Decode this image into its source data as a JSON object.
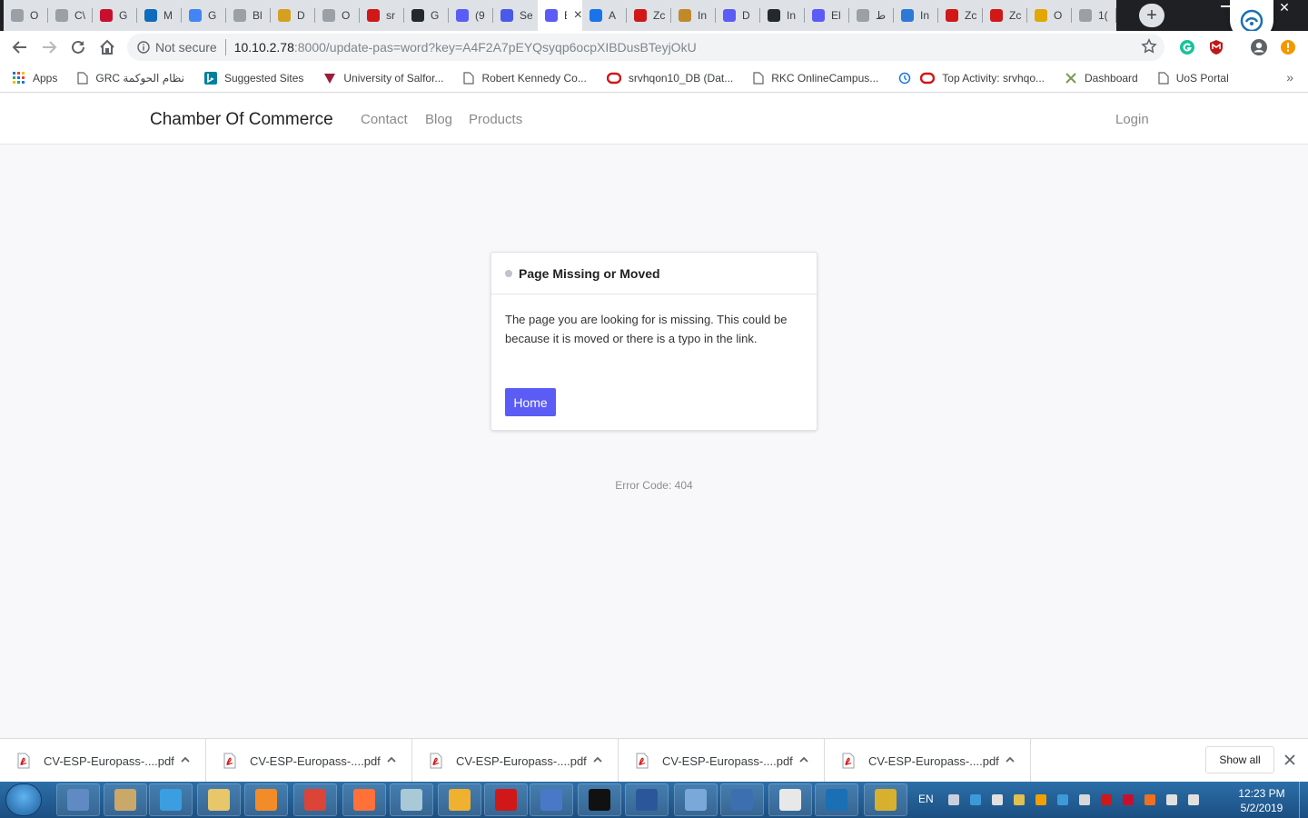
{
  "browser": {
    "tabs": [
      {
        "title": "O"
      },
      {
        "title": "C\\"
      },
      {
        "title": "G"
      },
      {
        "title": "M"
      },
      {
        "title": "G"
      },
      {
        "title": "Bl"
      },
      {
        "title": "D"
      },
      {
        "title": "O"
      },
      {
        "title": "sr"
      },
      {
        "title": "G"
      },
      {
        "title": "(9"
      },
      {
        "title": "Se"
      },
      {
        "title": "E"
      },
      {
        "title": "A"
      },
      {
        "title": "Zc"
      },
      {
        "title": "In"
      },
      {
        "title": "D"
      },
      {
        "title": "In"
      },
      {
        "title": "El"
      },
      {
        "title": "ط"
      },
      {
        "title": "In"
      },
      {
        "title": "Zc"
      },
      {
        "title": "Zc"
      },
      {
        "title": "O"
      },
      {
        "title": "1("
      }
    ],
    "active_tab_index": 12,
    "new_tab_label": "+",
    "window_close_glyph": "✕",
    "security_label": "Not secure",
    "url_host": "10.10.2.78",
    "url_rest": ":8000/update-pas=word?key=A4F2A7pEYQsyqp6ocpXIBDusBTeyjOkU",
    "bookmarks": [
      {
        "label": "Apps",
        "icon": "apps-icon"
      },
      {
        "label": "GRC نظام الحوكمة",
        "icon": "page-icon"
      },
      {
        "label": "Suggested Sites",
        "icon": "bing-icon"
      },
      {
        "label": "University of Salfor...",
        "icon": "salford-icon"
      },
      {
        "label": "Robert Kennedy Co...",
        "icon": "page-icon"
      },
      {
        "label": "srvhqon10_DB (Dat...",
        "icon": "oracle-icon"
      },
      {
        "label": "RKC OnlineCampus...",
        "icon": "page-icon"
      },
      {
        "label": "",
        "icon": "history-icon"
      },
      {
        "label": "Top Activity: srvhqo...",
        "icon": "oracle-icon"
      },
      {
        "label": "Dashboard",
        "icon": "dashboard-icon"
      },
      {
        "label": "UoS Portal",
        "icon": "page-icon"
      }
    ],
    "bookmarks_more": "»"
  },
  "site": {
    "brand": "Chamber Of Commerce",
    "nav": [
      "Contact",
      "Blog",
      "Products"
    ],
    "login": "Login"
  },
  "error_card": {
    "title": "Page Missing or Moved",
    "message": "The page you are looking for is missing. This could be because it is moved or there is a typo in the link.",
    "button": "Home",
    "accent_color": "#5b5cf5"
  },
  "error_code": "Error Code: 404",
  "downloads": {
    "items": [
      "CV-ESP-Europass-....pdf",
      "CV-ESP-Europass-....pdf",
      "CV-ESP-Europass-....pdf",
      "CV-ESP-Europass-....pdf",
      "CV-ESP-Europass-....pdf"
    ],
    "show_all": "Show all",
    "close_glyph": "✕"
  },
  "taskbar": {
    "language": "EN",
    "time": "12:23 PM",
    "date": "5/2/2019"
  }
}
